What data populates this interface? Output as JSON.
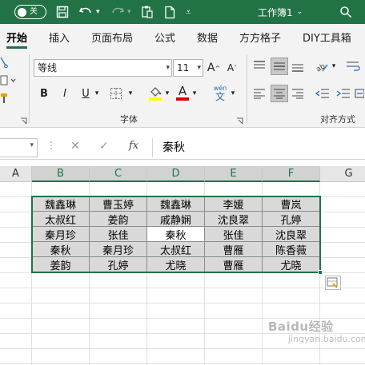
{
  "titlebar": {
    "autosave_state": "关",
    "workbook_title": "工作簿1",
    "title_chevron": "⌄",
    "bg_color": "#217346"
  },
  "tabs": [
    "开始",
    "插入",
    "页面布局",
    "公式",
    "数据",
    "方方格子",
    "DIY工具箱"
  ],
  "ribbon": {
    "font_name": "等线",
    "font_size": "11",
    "bold_label": "B",
    "italic_label": "I",
    "underline_label": "U",
    "font_color_label": "A",
    "phonetic_label": "wén",
    "grow_font_label": "A",
    "shrink_font_label": "A",
    "font_group_label": "字体",
    "align_group_label": "对齐方式"
  },
  "formula_bar": {
    "fx_label": "fx",
    "content": "秦秋"
  },
  "columns": [
    "A",
    "B",
    "C",
    "D",
    "E",
    "F",
    "G"
  ],
  "rows": [
    [
      "魏鑫琳",
      "曹玉婷",
      "魏鑫琳",
      "李媛",
      "曹岚"
    ],
    [
      "太叔红",
      "姜韵",
      "戚静娴",
      "沈良翠",
      "孔婷"
    ],
    [
      "秦月珍",
      "张佳",
      "秦秋",
      "张佳",
      "沈良翠"
    ],
    [
      "秦秋",
      "秦月珍",
      "太叔红",
      "曹雁",
      "陈香薇"
    ],
    [
      "姜韵",
      "孔婷",
      "尤晓",
      "曹雁",
      "尤晓"
    ]
  ],
  "watermark": {
    "text": "Baidu经验",
    "sub": "jingyan.baidu.com"
  }
}
